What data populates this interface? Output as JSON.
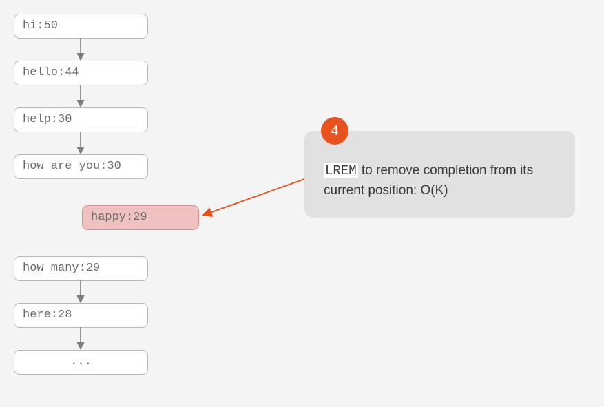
{
  "list": {
    "nodes": [
      {
        "label": "hi:50"
      },
      {
        "label": "hello:44"
      },
      {
        "label": "help:30"
      },
      {
        "label": "how are you:30"
      },
      {
        "label": "happy:29",
        "highlight": true
      },
      {
        "label": "how many:29"
      },
      {
        "label": "here:28"
      },
      {
        "label": "..."
      }
    ]
  },
  "callout": {
    "step": "4",
    "code": "LREM",
    "text_after_code": " to remove completion from its current position: O(K)"
  },
  "arrow_color": "#e7521e",
  "list_arrow_color": "#7d7d7d"
}
